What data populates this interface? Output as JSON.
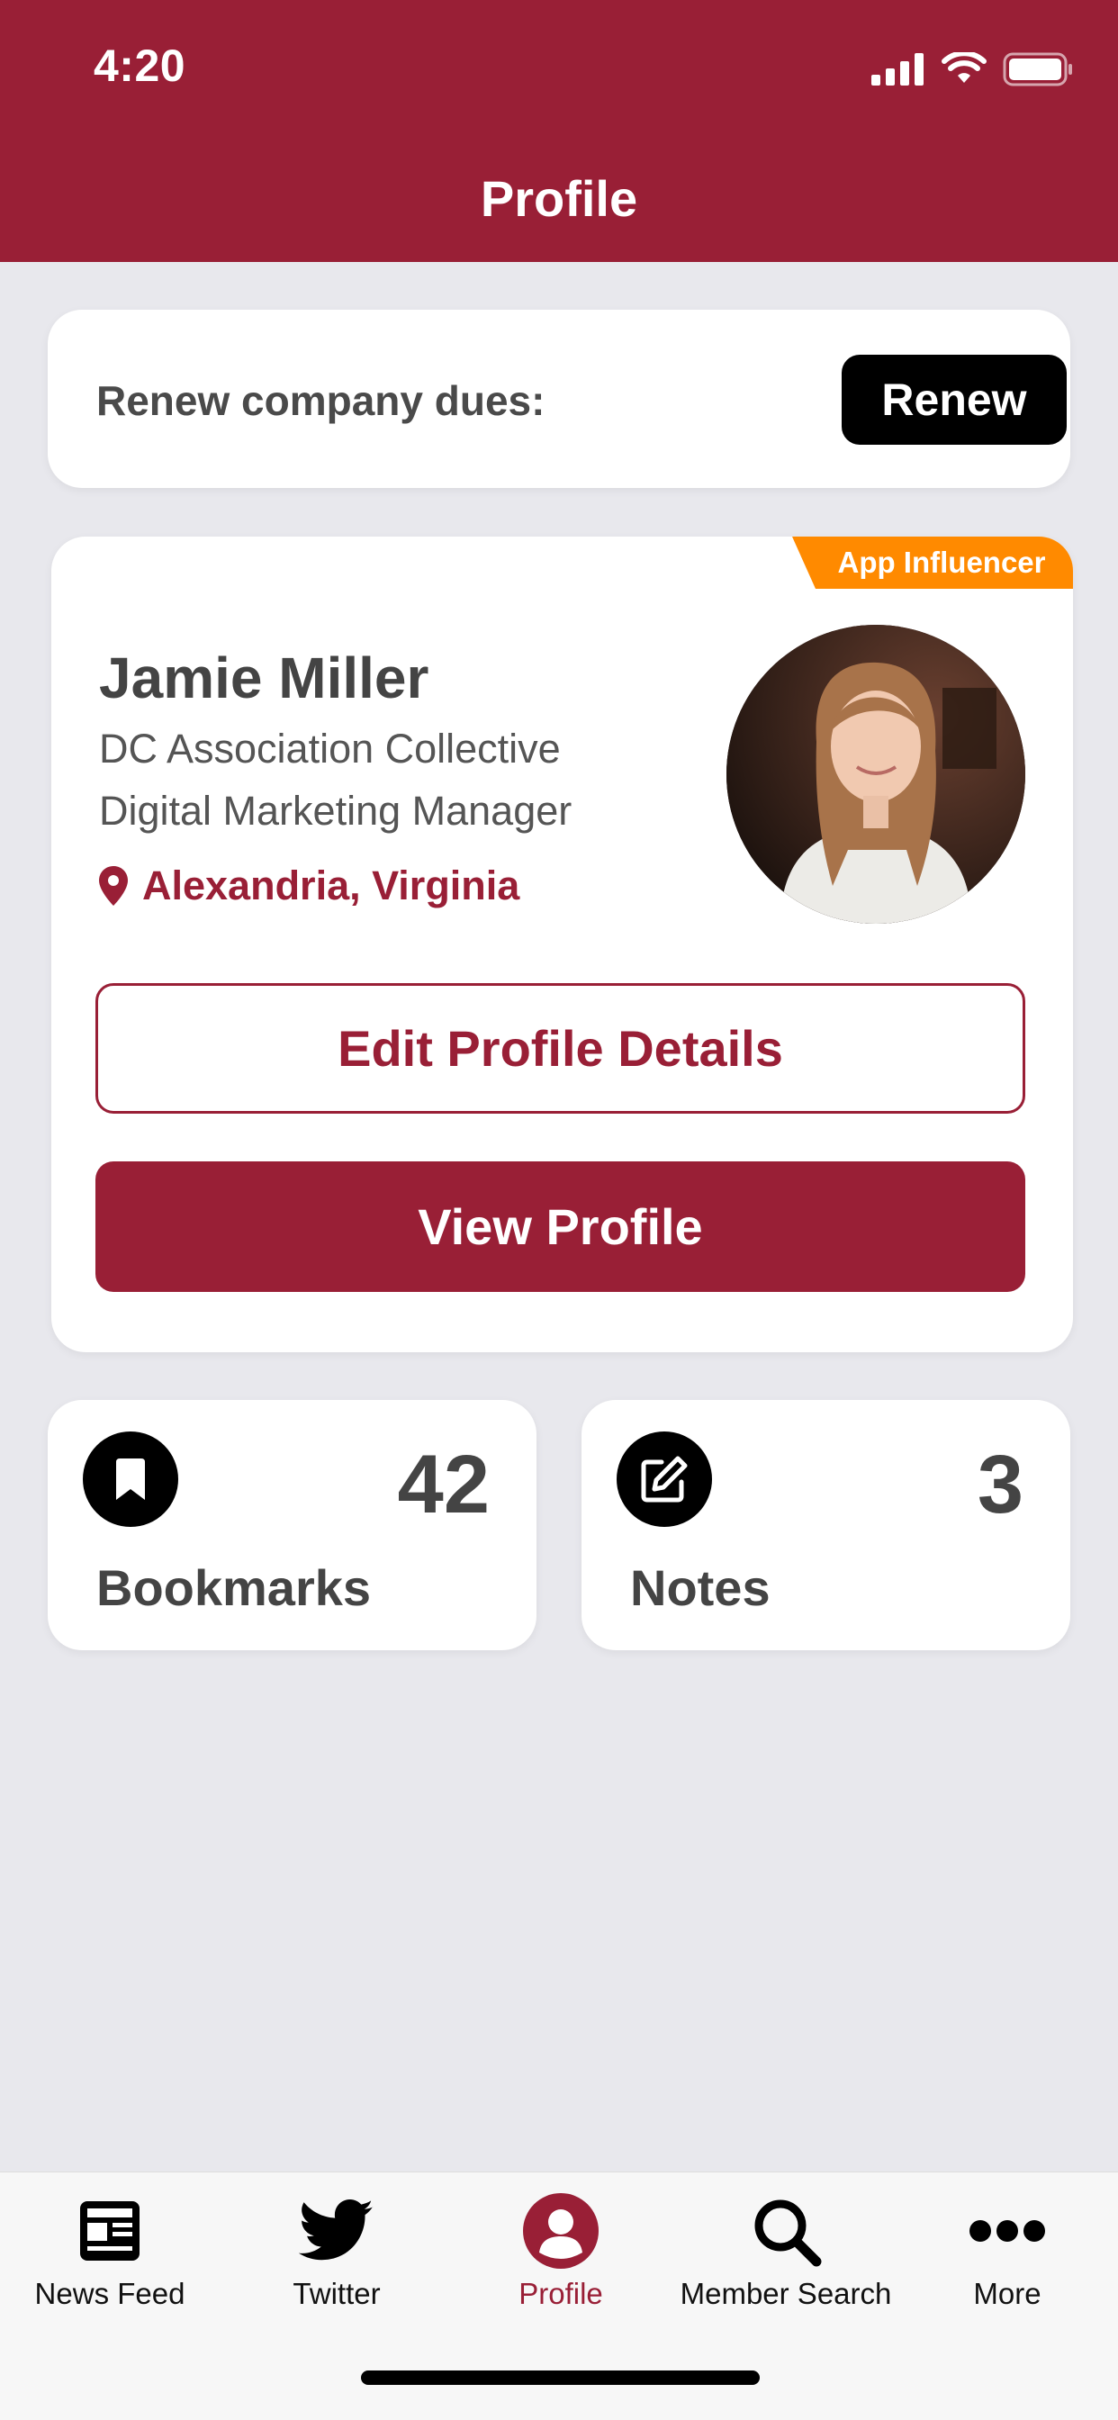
{
  "status_bar": {
    "time": "4:20"
  },
  "header": {
    "title": "Profile"
  },
  "renew": {
    "label": "Renew company dues:",
    "button": "Renew"
  },
  "profile": {
    "badge": "App Influencer",
    "name": "Jamie Miller",
    "organization": "DC Association Collective",
    "role": "Digital Marketing Manager",
    "location": "Alexandria, Virginia",
    "edit_button": "Edit Profile Details",
    "view_button": "View Profile"
  },
  "stats": [
    {
      "label": "Bookmarks",
      "count": "42",
      "icon": "bookmark-icon"
    },
    {
      "label": "Notes",
      "count": "3",
      "icon": "edit-note-icon"
    }
  ],
  "tabs": [
    {
      "label": "News Feed",
      "icon": "newspaper-icon",
      "active": false
    },
    {
      "label": "Twitter",
      "icon": "twitter-icon",
      "active": false
    },
    {
      "label": "Profile",
      "icon": "user-icon",
      "active": true
    },
    {
      "label": "Member Search",
      "icon": "search-icon",
      "active": false
    },
    {
      "label": "More",
      "icon": "more-icon",
      "active": false
    }
  ],
  "colors": {
    "brand": "#991f36",
    "badge": "#ff8a00",
    "background": "#e8e8ed"
  }
}
